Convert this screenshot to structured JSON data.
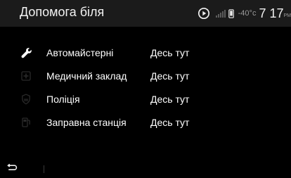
{
  "header": {
    "title": "Допомога біля",
    "temperature": "-40°c",
    "time": "7 17",
    "ampm": "PM",
    "icons": [
      "play-circle-icon",
      "signal-bars-icon",
      "phone-icon"
    ]
  },
  "list": [
    {
      "icon": "wrench-icon",
      "label": "Автомайстерні",
      "value": "Десь тут",
      "icon_color": "#ffffff"
    },
    {
      "icon": "medical-cross-icon",
      "label": "Медичний заклад",
      "value": "Десь тут",
      "icon_color": "#2a2a2a"
    },
    {
      "icon": "police-badge-icon",
      "label": "Поліція",
      "value": "Десь тут",
      "icon_color": "#2a2a2a"
    },
    {
      "icon": "fuel-pump-icon",
      "label": "Заправна станція",
      "value": "Десь тут",
      "icon_color": "#2a2a2a"
    }
  ],
  "footer": {
    "back_icon": "back-arrow-icon"
  },
  "colors": {
    "background": "#000000",
    "header_background": "#1b1b1b",
    "text": "#ffffff",
    "muted": "#9a9a9a"
  }
}
